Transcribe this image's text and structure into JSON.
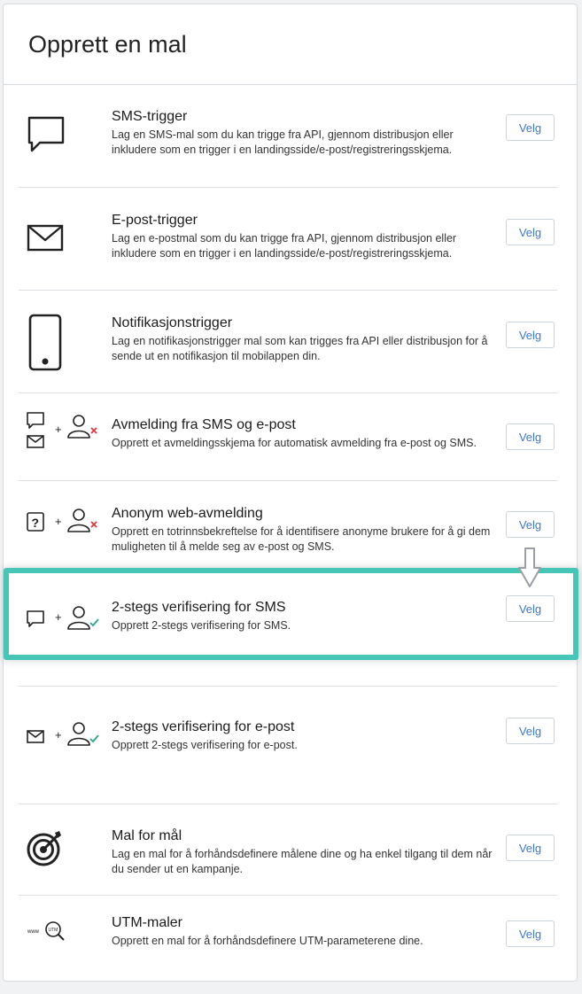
{
  "header": {
    "title": "Opprett en mal"
  },
  "templates": [
    {
      "title": "SMS-trigger",
      "description": "Lag en SMS-mal som du kan trigge fra API, gjennom distribusjon eller inkludere som en trigger i en landingsside/e-post/registreringsskjema.",
      "button": "Velg",
      "icon": "sms-bubble-icon"
    },
    {
      "title": "E-post-trigger",
      "description": "Lag en e-postmal som du kan trigge fra API, gjennom distribusjon eller inkludere som en trigger i en landingsside/e-post/registreringsskjema.",
      "button": "Velg",
      "icon": "envelope-icon"
    },
    {
      "title": "Notifikasjonstrigger",
      "description": "Lag en notifikasjonstrigger mal som kan trigges fra API eller distribusjon for å sende ut en notifikasjon til mobilappen din.",
      "button": "Velg",
      "icon": "mobile-phone-icon"
    },
    {
      "title": "Avmelding fra SMS og e-post",
      "description": "Opprett et avmeldingsskjema for automatisk avmelding fra e-post og SMS.",
      "button": "Velg",
      "icon": "sms-email-unsubscribe-icon"
    },
    {
      "title": "Anonym web-avmelding",
      "description": "Opprett en totrinnsbekreftelse for å identifisere anonyme brukere for å gi dem muligheten til å melde seg av e-post og SMS.",
      "button": "Velg",
      "icon": "anonymous-unsubscribe-icon"
    },
    {
      "title": "2-stegs verifisering for SMS",
      "description": "Opprett 2-stegs verifisering for SMS.",
      "button": "Velg",
      "icon": "sms-verification-icon"
    },
    {
      "title": "2-stegs verifisering for e-post",
      "description": "Opprett 2-stegs verifisering for e-post.",
      "button": "Velg",
      "icon": "email-verification-icon"
    },
    {
      "title": "Mal for mål",
      "description": "Lag en mal for å forhåndsdefinere målene dine og ha enkel tilgang til dem når du sender ut en kampanje.",
      "button": "Velg",
      "icon": "target-icon"
    },
    {
      "title": "UTM-maler",
      "description": "Opprett en mal for å forhåndsdefinere UTM-parameterene dine.",
      "button": "Velg",
      "icon": "utm-search-icon"
    }
  ],
  "icon_text": {
    "www": "www",
    "utm": "UTM"
  },
  "colors": {
    "highlight": "#46c6b6",
    "button_text": "#3b78c7",
    "cross": "#e0383e",
    "check": "#2aa58a"
  }
}
